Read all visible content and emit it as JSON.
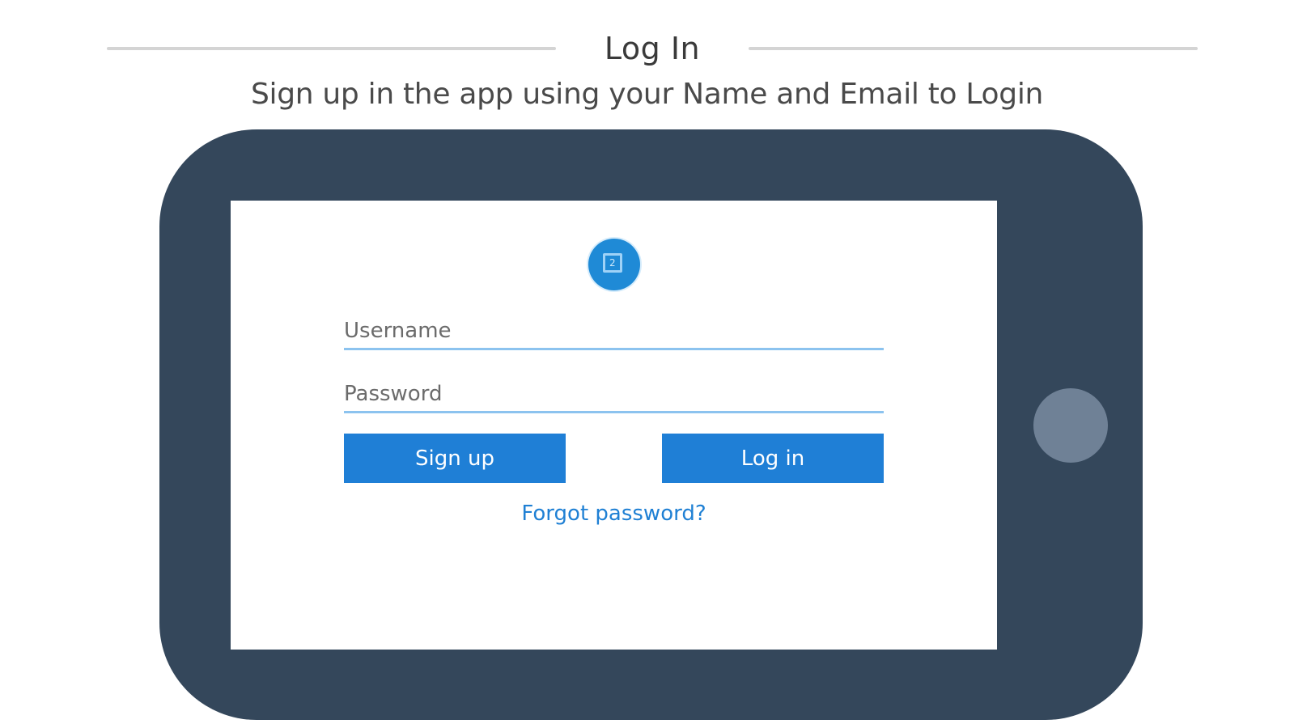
{
  "header": {
    "title": "Log In",
    "subtitle": "Sign up in the app using your Name and Email to Login"
  },
  "device": {
    "logo_icon": "app-logo-icon",
    "logo_glyph": "2",
    "form": {
      "username": {
        "value": "",
        "placeholder": "Username"
      },
      "password": {
        "value": "",
        "placeholder": "Password"
      },
      "signup_label": "Sign up",
      "login_label": "Log in",
      "forgot_label": "Forgot password?"
    },
    "home_button_icon": "home-button-icon"
  },
  "colors": {
    "device_body": "#34475b",
    "home_button": "#6f8196",
    "accent": "#1f7fd6",
    "field_underline": "#8cc3ef",
    "divider": "#d4d4d4"
  }
}
